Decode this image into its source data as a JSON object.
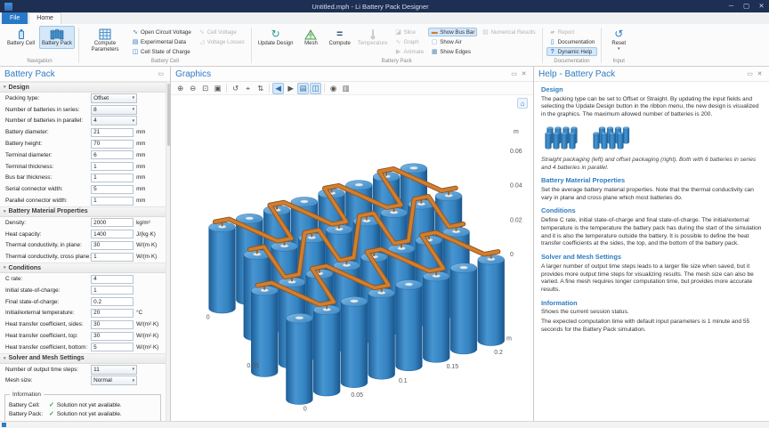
{
  "window": {
    "title": "Untitled.mph - Li Battery Pack Designer"
  },
  "ribbon": {
    "file_tab": "File",
    "home_tab": "Home",
    "groups": {
      "navigation": "Navigation",
      "battery_cell": "Battery Cell",
      "battery_pack": "Battery Pack",
      "documentation": "Documentation",
      "input": "Input"
    },
    "buttons": {
      "battery_cell": "Battery Cell",
      "battery_pack": "Battery Pack",
      "compute_parameters": "Compute Parameters",
      "open_circuit_voltage": "Open Circuit Voltage",
      "experimental_data": "Experimental Data",
      "cell_state_of_charge": "Cell State of Charge",
      "cell_voltage": "Cell Voltage",
      "voltage_losses": "Voltage Losses",
      "update_design": "Update Design",
      "mesh": "Mesh",
      "compute": "Compute",
      "temperature": "Temperature",
      "slice": "Slice",
      "graph": "Graph",
      "animate": "Animate",
      "show_bus_bar": "Show Bus Bar",
      "show_air": "Show Air",
      "show_edges": "Show Edges",
      "numerical_results": "Numerical Results",
      "report": "Report",
      "documentation": "Documentation",
      "dynamic_help": "Dynamic Help",
      "reset": "Reset"
    }
  },
  "settings": {
    "panel_title": "Battery Pack",
    "sections": [
      {
        "title": "Design",
        "rows": [
          {
            "label": "Packing type:",
            "value": "Offset",
            "type": "select"
          },
          {
            "label": "Number of batteries in series:",
            "value": "8",
            "type": "select"
          },
          {
            "label": "Number of batteries in parallel:",
            "value": "4",
            "type": "select"
          },
          {
            "label": "Battery diameter:",
            "value": "21",
            "unit": "mm"
          },
          {
            "label": "Battery height:",
            "value": "70",
            "unit": "mm"
          },
          {
            "label": "Terminal diameter:",
            "value": "6",
            "unit": "mm"
          },
          {
            "label": "Terminal thickness:",
            "value": "1",
            "unit": "mm"
          },
          {
            "label": "Bus bar thickness:",
            "value": "1",
            "unit": "mm"
          },
          {
            "label": "Serial connector width:",
            "value": "5",
            "unit": "mm"
          },
          {
            "label": "Parallel connector width:",
            "value": "1",
            "unit": "mm"
          }
        ]
      },
      {
        "title": "Battery Material Properties",
        "rows": [
          {
            "label": "Density:",
            "value": "2000",
            "unit": "kg/m³"
          },
          {
            "label": "Heat capacity:",
            "value": "1400",
            "unit": "J/(kg·K)"
          },
          {
            "label": "Thermal conductivity, in plane:",
            "value": "30",
            "unit": "W/(m·K)"
          },
          {
            "label": "Thermal conductivity, cross plane:",
            "value": "1",
            "unit": "W/(m·K)"
          }
        ]
      },
      {
        "title": "Conditions",
        "rows": [
          {
            "label": "C rate:",
            "value": "4"
          },
          {
            "label": "Initial state-of-charge:",
            "value": "1"
          },
          {
            "label": "Final state-of-charge:",
            "value": "0.2"
          },
          {
            "label": "Initial/external temperature:",
            "value": "20",
            "unit": "°C"
          },
          {
            "label": "Heat transfer coefficient, sides:",
            "value": "30",
            "unit": "W/(m²·K)"
          },
          {
            "label": "Heat transfer coefficient, top:",
            "value": "30",
            "unit": "W/(m²·K)"
          },
          {
            "label": "Heat transfer coefficient, bottom:",
            "value": "5",
            "unit": "W/(m²·K)"
          }
        ]
      },
      {
        "title": "Solver and Mesh Settings",
        "rows": [
          {
            "label": "Number of output time steps:",
            "value": "11",
            "type": "select"
          },
          {
            "label": "Mesh size:",
            "value": "Normal",
            "type": "select"
          }
        ]
      }
    ],
    "information": {
      "title": "Information",
      "rows": [
        {
          "label": "Battery Cell:",
          "status": "Solution not yet available."
        },
        {
          "label": "Battery Pack:",
          "status": "Solution not yet available."
        }
      ]
    }
  },
  "graphics": {
    "panel_title": "Graphics",
    "scene": {
      "series": 8,
      "parallel": 4
    },
    "toolbar": [
      {
        "glyph": "⊕",
        "name": "zoom-in-icon"
      },
      {
        "glyph": "⊖",
        "name": "zoom-out-icon"
      },
      {
        "glyph": "⊡",
        "name": "zoom-box-icon"
      },
      {
        "glyph": "▣",
        "name": "zoom-extents-icon"
      },
      {
        "sep": true
      },
      {
        "glyph": "↺",
        "name": "go-to-default-view-icon"
      },
      {
        "glyph": "⌖",
        "name": "center-view-icon"
      },
      {
        "glyph": "⇅",
        "name": "orbit-icon"
      },
      {
        "sep": true
      },
      {
        "glyph": "◀",
        "name": "previous-view-icon",
        "selected": true
      },
      {
        "glyph": "▶",
        "name": "next-view-icon"
      },
      {
        "glyph": "▤",
        "name": "scene-light-icon",
        "selected": true
      },
      {
        "glyph": "◫",
        "name": "transparency-icon",
        "selected": true
      },
      {
        "sep": true
      },
      {
        "glyph": "◉",
        "name": "snapshot-icon"
      },
      {
        "glyph": "▥",
        "name": "print-icon"
      }
    ],
    "axes": {
      "unit": "m",
      "vertical": [
        "0.06",
        "0.04",
        "0.02",
        "0"
      ],
      "front": [
        "0",
        "0.05",
        "0.1",
        "0.15",
        "0.2"
      ],
      "left": [
        "0",
        "0.05"
      ]
    },
    "colors": {
      "battery_blue": "#3584c2",
      "bus_bar_orange": "#d07f30"
    }
  },
  "help": {
    "panel_title": "Help - Battery Pack",
    "design": {
      "heading": "Design",
      "body": "The packing type can be set to Offset or Straight. By updating the input fields and selecting the Update Design button in the ribbon menu, the new design is visualized in the graphics. The maximum allowed number of batteries is 200.",
      "caption": "Straight packaging (left) and offset packaging (right). Both with 6 batteries in series and 4 batteries in parallel."
    },
    "material": {
      "heading": "Battery Material Properties",
      "body": "Set the average battery material properties. Note that the thermal conductivity can vary in plane and cross plane which most batteries do."
    },
    "conditions": {
      "heading": "Conditions",
      "body": "Define C rate, initial state-of-charge and final state-of-charge. The initial/external temperature is the temperature the battery pack has during the start of the simulation and it is also the temperature outside the battery. It is possible to define the heat transfer coefficients at the sides, the top, and the bottom of the battery pack."
    },
    "solver": {
      "heading": "Solver and Mesh Settings",
      "body": "A larger number of output time steps leads to a larger file size when saved, but it provides more output time steps for visualizing results. The mesh size can also be varied. A fine mesh requires longer computation time, but provides more accurate results."
    },
    "information": {
      "heading": "Information",
      "p1": "Shows the current session status.",
      "p2": "The expected computation time with default input parameters is 1 minute and 55 seconds for the Battery Pack simulation."
    }
  }
}
